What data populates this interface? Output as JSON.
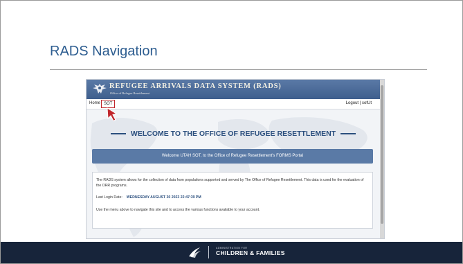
{
  "slide": {
    "title": "RADS Navigation"
  },
  "rads": {
    "system_title": "REFUGEE ARRIVALS DATA SYSTEM (RADS)",
    "office_subtitle": "Office of Refugee Resettlement",
    "nav": {
      "home": "Home",
      "sot": "SOT",
      "logout": "Logout",
      "separator": "|",
      "user": "sotUt"
    },
    "welcome_heading": "WELCOME TO THE OFFICE OF REFUGEE RESETTLEMENT",
    "welcome_banner": "Welcome UTAH SOT, to the Office of Refugee Resettlement's FORMS Portal",
    "description": "The RADS system allows for the collection of data from populations supported and served by The Office of Refugee Resettlement. This data is used for the evaluation of the ORR programs.",
    "last_login_label": "Last Login Date:",
    "last_login_value": "WEDNESDAY AUGUST 30 2023 22:47:39 PM",
    "menu_hint": "Use the menu above to navigate this site and to access the various functions available to your account."
  },
  "footer": {
    "admin_line": "ADMINISTRATION FOR",
    "org_name": "CHILDREN & FAMILIES"
  },
  "colors": {
    "title": "#2d5d90",
    "header": "#4a6a98",
    "banner": "#5a7aa6",
    "highlight": "#c0262c",
    "footer": "#17243a"
  },
  "icons": [
    "eagle-seal-icon",
    "mouse-pointer-icon",
    "hhs-logo-icon"
  ]
}
